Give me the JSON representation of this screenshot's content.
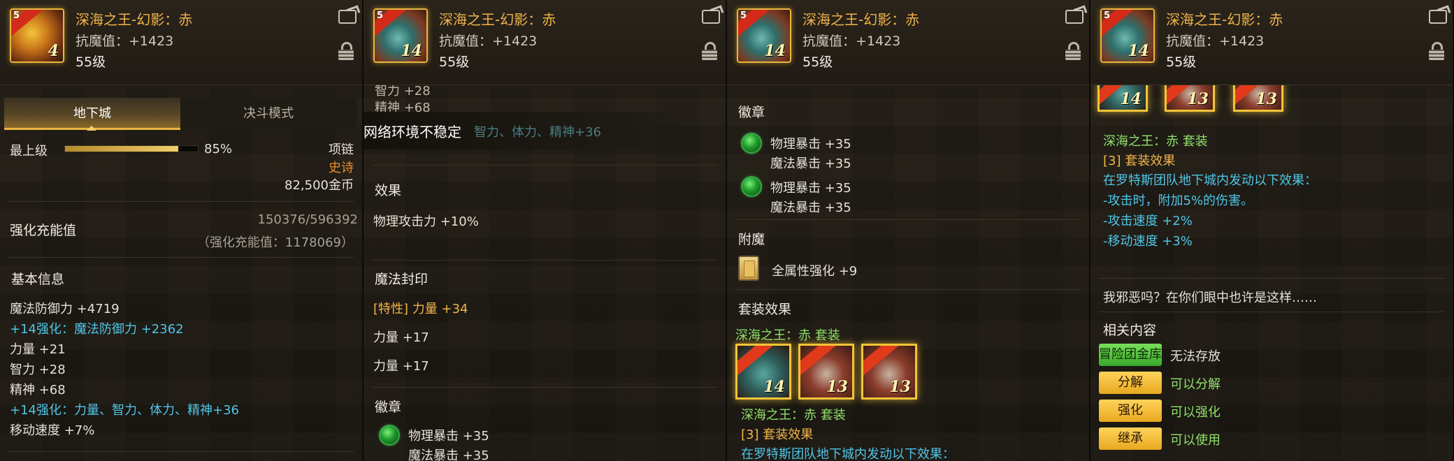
{
  "header": {
    "title": "深海之王-幻影：赤",
    "stat": "抗魔值：+1423",
    "level": "55级",
    "icon_levels": [
      "4",
      "14",
      "14",
      "14"
    ]
  },
  "panel1": {
    "tabs": [
      "地下城",
      "决斗模式"
    ],
    "grade_label": "最上级",
    "grade_percent": "85%",
    "grade_fill": 0.85,
    "slot": "项链",
    "rarity": "史诗",
    "price": "82,500金币",
    "charge_label": "强化充能值",
    "charge_value": "150376/596392",
    "charge_total": "（强化充能值：1178069）",
    "basic_title": "基本信息",
    "basic_lines": [
      {
        "text": "魔法防御力 +4719",
        "color": "normal"
      },
      {
        "text": "+14强化：魔法防御力 +2362",
        "color": "cyan"
      },
      {
        "text": "力量 +21",
        "color": "normal"
      },
      {
        "text": "智力 +28",
        "color": "normal"
      },
      {
        "text": "精神 +68",
        "color": "normal"
      },
      {
        "text": "+14强化：力量、智力、体力、精神+36",
        "color": "cyan"
      },
      {
        "text": "移动速度 +7%",
        "color": "normal"
      }
    ]
  },
  "panel2": {
    "top_lines": [
      "智力 +28",
      "精神 +68"
    ],
    "toast": "网络环境不稳定",
    "faded_line": "智力、体力、精神+36",
    "effect_title": "效果",
    "effect_line": "物理攻击力 +10%",
    "seal_title": "魔法封印",
    "seal_lines": [
      "[特性] 力量 +34",
      "力量 +17",
      "力量 +17"
    ],
    "emblem_title": "徽章",
    "emblem_lines": [
      "物理暴击 +35",
      "魔法暴击 +35"
    ]
  },
  "panel3": {
    "emblem_title": "徽章",
    "emblems": [
      {
        "a": "物理暴击 +35",
        "b": "魔法暴击 +35"
      },
      {
        "a": "物理暴击 +35",
        "b": "魔法暴击 +35"
      }
    ],
    "enchant_title": "附魔",
    "enchant_line": "全属性强化 +9",
    "set_title": "套装效果",
    "set_name_top": "深海之王：赤 套装",
    "set_levels": [
      "14",
      "13",
      "13"
    ],
    "set_name": "深海之王：赤 套装",
    "set_effect": "[3] 套装效果",
    "set_desc": "在罗特斯团队地下城内发动以下效果："
  },
  "panel4": {
    "set_levels": [
      "14",
      "13",
      "13"
    ],
    "set_name": "深海之王：赤 套装",
    "set_effect": "[3] 套装效果",
    "set_lines": [
      "在罗特斯团队地下城内发动以下效果：",
      "-攻击时，附加5%的伤害。",
      "-攻击速度 +2%",
      "-移动速度 +3%"
    ],
    "flavor": "我邪恶吗？在你们眼中也许是这样……",
    "related_title": "相关内容",
    "related": [
      {
        "button": "冒险团金库",
        "text": "无法存放",
        "style": "green"
      },
      {
        "button": "分解",
        "text": "可以分解",
        "style": "gold"
      },
      {
        "button": "强化",
        "text": "可以强化",
        "style": "gold"
      },
      {
        "button": "继承",
        "text": "可以使用",
        "style": "gold"
      }
    ]
  }
}
